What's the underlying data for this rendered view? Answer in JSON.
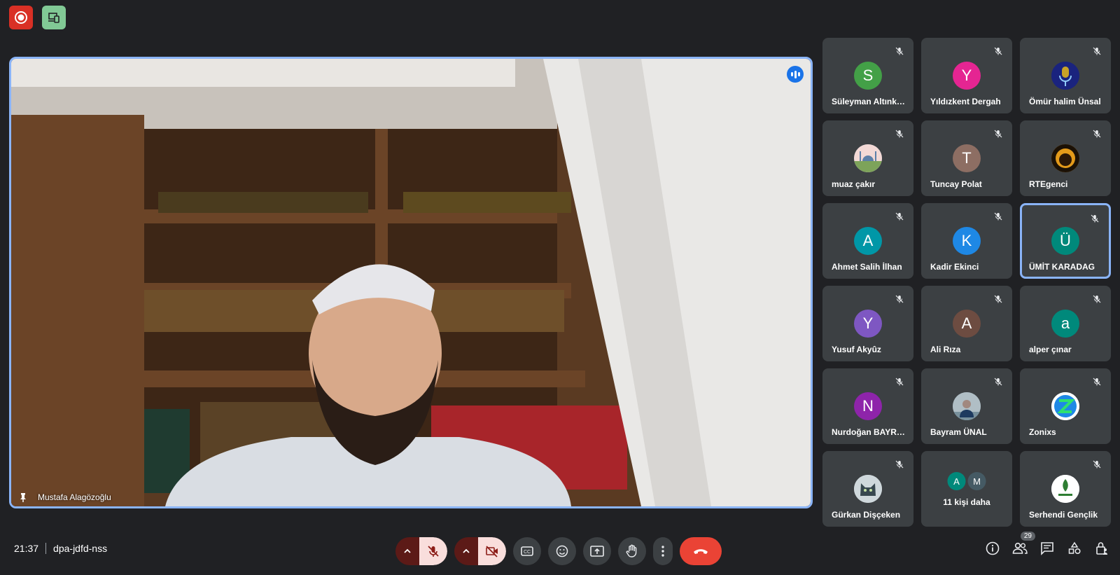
{
  "meeting": {
    "time": "21:37",
    "code": "dpa-jdfd-nss"
  },
  "main_speaker": {
    "name": "Mustafa Alagözoğlu"
  },
  "participants": [
    {
      "name": "Süleyman Altınkaya",
      "initial": "S",
      "color": "#43a047"
    },
    {
      "name": "Yıldızkent Dergah",
      "initial": "Y",
      "color": "#e52592"
    },
    {
      "name": "Ömür halim Ünsal",
      "initial": "",
      "color": "#1a237e",
      "icon": "microphone-avatar-icon"
    },
    {
      "name": "muaz çakır",
      "initial": "",
      "color": "#8fa7c4",
      "icon": "mosque-avatar-icon"
    },
    {
      "name": "Tuncay Polat",
      "initial": "T",
      "color": "#8d6e63"
    },
    {
      "name": "RTEgenci",
      "initial": "",
      "color": "#c77800",
      "icon": "silhouette-avatar-icon"
    },
    {
      "name": "Ahmet Salih İlhan",
      "initial": "A",
      "color": "#0097a7"
    },
    {
      "name": "Kadir Ekinci",
      "initial": "K",
      "color": "#1e88e5"
    },
    {
      "name": "ÜMİT KARADAG",
      "initial": "Ü",
      "color": "#00897b",
      "active": true
    },
    {
      "name": "Yusuf Akyûz",
      "initial": "Y",
      "color": "#7e57c2"
    },
    {
      "name": "Ali Rıza",
      "initial": "A",
      "color": "#6d4c41"
    },
    {
      "name": "alper çınar",
      "initial": "a",
      "color": "#00897b"
    },
    {
      "name": "Nurdoğan BAYRAK",
      "initial": "N",
      "color": "#8e24aa"
    },
    {
      "name": "Bayram ÜNAL",
      "initial": "",
      "color": "#90a4ae",
      "icon": "person-photo-avatar-icon"
    },
    {
      "name": "Zonixs",
      "initial": "",
      "color": "#ffffff",
      "icon": "z-logo-avatar-icon"
    },
    {
      "name": "Gürkan Dişçeken",
      "initial": "",
      "color": "#cfd8dc",
      "icon": "cat-avatar-icon"
    },
    {
      "name": "Serhendi Gençlik",
      "initial": "",
      "color": "#ffffff",
      "icon": "serhendi-logo-avatar-icon"
    }
  ],
  "more_tile": {
    "label": "11 kişi daha",
    "avatars": [
      {
        "initial": "A",
        "color": "#00897b"
      },
      {
        "initial": "M",
        "color": "#455a64"
      }
    ]
  },
  "people_count": "29",
  "colors": {
    "accent": "#8ab4f8",
    "leave": "#ea4335",
    "tile_bg": "#3c4043"
  }
}
